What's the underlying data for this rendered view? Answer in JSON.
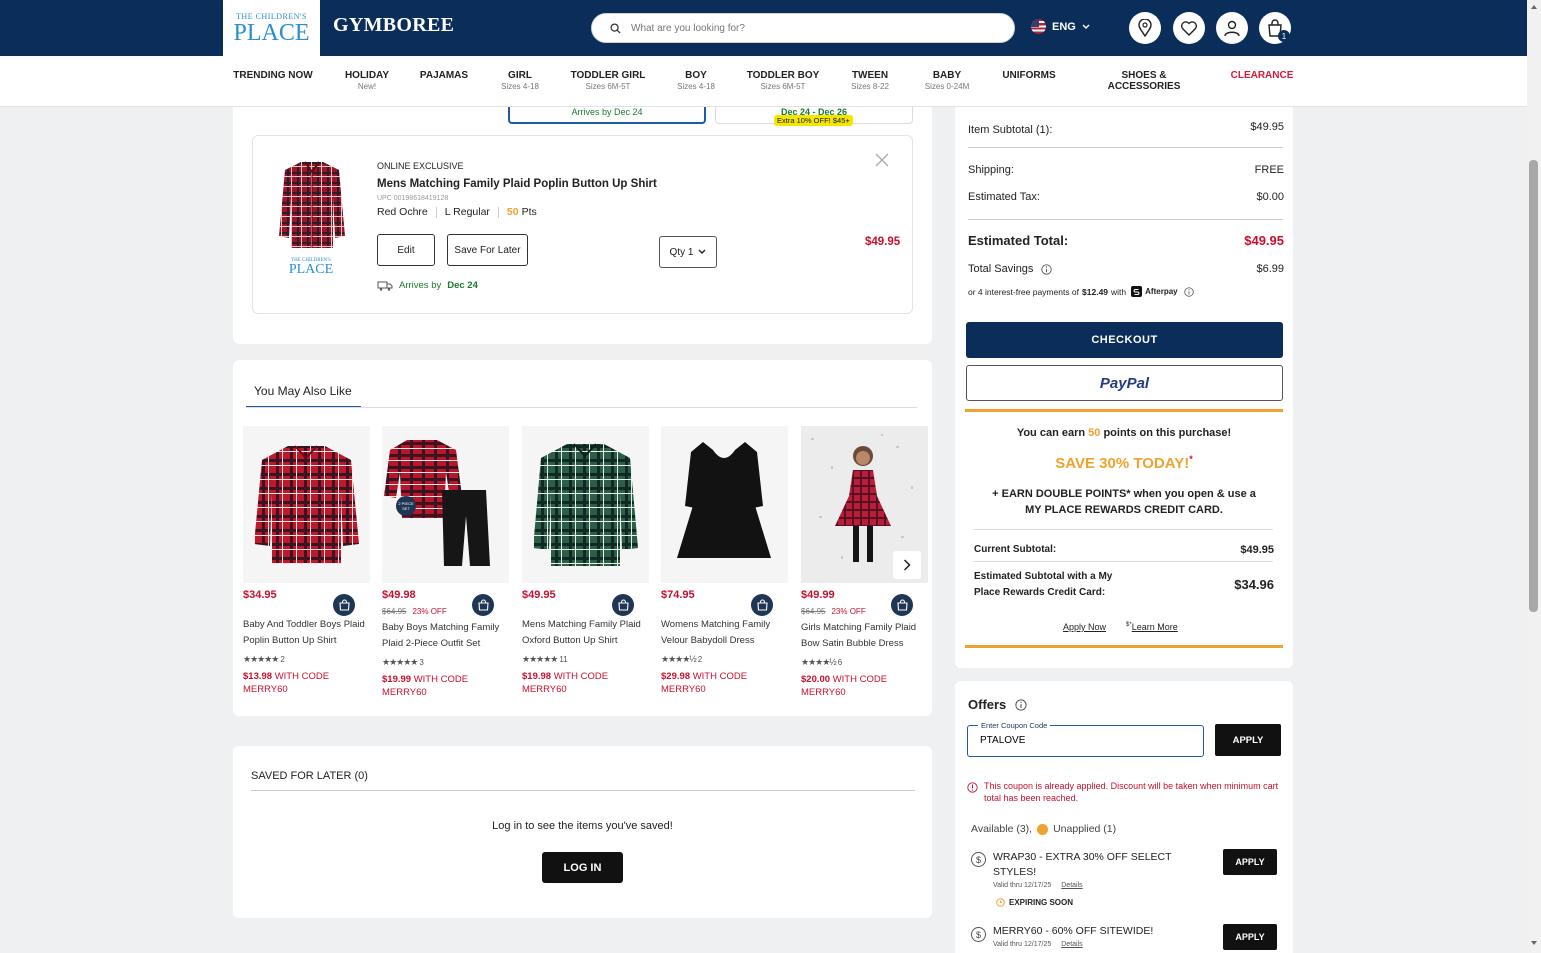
{
  "header": {
    "logo_tcp_line1": "THE CHILDREN'S",
    "logo_tcp_line2": "PLACE",
    "logo_gymboree": "GYMBOREE",
    "search_placeholder": "What are you looking for?",
    "language": "ENG",
    "cart_count": "1"
  },
  "nav": [
    {
      "label": "TRENDING NOW",
      "sub": ""
    },
    {
      "label": "HOLIDAY",
      "sub": "New!"
    },
    {
      "label": "PAJAMAS",
      "sub": ""
    },
    {
      "label": "GIRL",
      "sub": "Sizes 4-18"
    },
    {
      "label": "TODDLER GIRL",
      "sub": "Sizes 6M-5T"
    },
    {
      "label": "BOY",
      "sub": "Sizes 4-18"
    },
    {
      "label": "TODDLER BOY",
      "sub": "Sizes 6M-5T"
    },
    {
      "label": "TWEEN",
      "sub": "Sizes 8-22"
    },
    {
      "label": "BABY",
      "sub": "Sizes 0-24M"
    },
    {
      "label": "UNIFORMS",
      "sub": ""
    },
    {
      "label": "SHOES &",
      "sub2": "ACCESSORIES"
    },
    {
      "label": "CLEARANCE",
      "sub": ""
    }
  ],
  "shipping_options": {
    "option1": "Arrives by Dec 24",
    "option2_dates": "Dec 24 - Dec 26",
    "option2_promo": "Extra 10% OFF! $45+"
  },
  "cart_item": {
    "tag": "ONLINE EXCLUSIVE",
    "name": "Mens Matching Family Plaid Poplin Button Up Shirt",
    "upc": "UPC 00198618419128",
    "color": "Red Ochre",
    "size": "L Regular",
    "points": "50",
    "points_suffix": "Pts",
    "edit": "Edit",
    "save_for_later": "Save For Later",
    "qty": "Qty 1",
    "price": "$49.95",
    "arrives_label": "Arrives by",
    "arrives_date": "Dec 24",
    "brand_line1": "THE CHILDREN'S",
    "brand_line2": "PLACE"
  },
  "recs": {
    "title": "You May Also Like",
    "items": [
      {
        "price": "$34.95",
        "was": "",
        "off": "",
        "name1": "Baby And Toddler Boys Plaid",
        "name2": "Poplin Button Up Shirt",
        "stars": "★★★★★",
        "reviews": "2",
        "promo_price": "$13.98",
        "promo_text": "WITH CODE",
        "promo_code": "MERRY60",
        "badge": ""
      },
      {
        "price": "$49.98",
        "was": "$64.95",
        "off": "23% OFF",
        "name1": "Baby Boys Matching Family",
        "name2": "Plaid 2-Piece Outfit Set",
        "stars": "★★★★★",
        "reviews": "3",
        "promo_price": "$19.99",
        "promo_text": "WITH CODE",
        "promo_code": "MERRY60",
        "badge": "2 PIECE SET"
      },
      {
        "price": "$49.95",
        "was": "",
        "off": "",
        "name1": "Mens Matching Family Plaid",
        "name2": "Oxford Button Up Shirt",
        "stars": "★★★★★",
        "reviews": "11",
        "promo_price": "$19.98",
        "promo_text": "WITH CODE",
        "promo_code": "MERRY60",
        "badge": ""
      },
      {
        "price": "$74.95",
        "was": "",
        "off": "",
        "name1": "Womens Matching Family",
        "name2": "Velour Babydoll Dress",
        "stars": "★★★★½",
        "reviews": "2",
        "promo_price": "$29.98",
        "promo_text": "WITH CODE",
        "promo_code": "MERRY60",
        "badge": ""
      },
      {
        "price": "$49.99",
        "was": "$64.95",
        "off": "23% OFF",
        "name1": "Girls Matching Family Plaid",
        "name2": "Bow Satin Bubble Dress",
        "stars": "★★★★½",
        "reviews": "6",
        "promo_price": "$20.00",
        "promo_text": "WITH CODE",
        "promo_code": "MERRY60",
        "badge": ""
      }
    ]
  },
  "saved": {
    "title": "SAVED FOR LATER (0)",
    "message": "Log in to see the items you've saved!",
    "login": "LOG IN"
  },
  "summary": {
    "item_subtotal_label": "Item Subtotal (1):",
    "item_subtotal": "$49.95",
    "shipping_label": "Shipping:",
    "shipping": "FREE",
    "tax_label": "Estimated Tax:",
    "tax": "$0.00",
    "total_label": "Estimated Total:",
    "total": "$49.95",
    "savings_label": "Total Savings",
    "savings": "$6.99",
    "afterpay_pre": "or 4 interest-free payments of",
    "afterpay_amount": "$12.49",
    "afterpay_with": "with",
    "afterpay_brand": "Afterpay",
    "checkout": "CHECKOUT",
    "paypal": "PayPal"
  },
  "rewards": {
    "earn_pre": "You can earn",
    "earn_points": "50",
    "earn_post": "points on this purchase!",
    "save_headline": "SAVE 30% TODAY!",
    "save_mark": "*",
    "double_line1": "+ EARN DOUBLE POINTS* when you open & use a",
    "double_line2": "MY PLACE REWARDS CREDIT CARD.",
    "current_label": "Current Subtotal:",
    "current": "$49.95",
    "est_label1": "Estimated Subtotal with a My",
    "est_label2": "Place Rewards Credit Card:",
    "est": "$34.96",
    "apply_now": "Apply Now",
    "learn_mark": "$*",
    "learn_more": "Learn More"
  },
  "offers": {
    "title": "Offers",
    "coupon_label": "Enter Coupon Code",
    "coupon_value": "PTALOVE",
    "apply": "APPLY",
    "error_line1": "This coupon is already applied. Discount will be taken when minimum cart",
    "error_line2": "total has been reached.",
    "available": "Available (3),",
    "unapplied": "Unapplied (1)",
    "coupons": [
      {
        "title1": "WRAP30 - EXTRA 30% OFF SELECT",
        "title2": "STYLES!",
        "valid": "Valid thru 12/17/25",
        "details": "Details",
        "badge": "EXPIRING SOON",
        "apply": "APPLY"
      },
      {
        "title1": "MERRY60 - 60% OFF SITEWIDE!",
        "title2": "",
        "valid": "Valid thru 12/17/25",
        "details": "Details",
        "badge": "",
        "apply": "APPLY"
      }
    ]
  },
  "colors": {
    "navy": "#0a2d5a",
    "red": "#c8102e",
    "gold": "#f0a22e",
    "green": "#1a7a2e"
  }
}
